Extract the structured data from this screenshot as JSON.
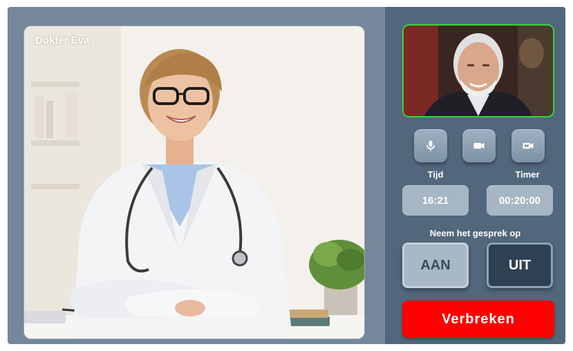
{
  "main_video": {
    "caller_name": "Dokter Eva"
  },
  "controls": {
    "icons": [
      "microphone-icon",
      "camera-icon",
      "video-off-icon"
    ]
  },
  "time": {
    "label": "Tijd",
    "value": "16:21"
  },
  "timer": {
    "label": "Timer",
    "value": "00:20:00"
  },
  "recording": {
    "label": "Neem het gesprek op",
    "on_label": "AAN",
    "off_label": "UIT",
    "selected": "UIT"
  },
  "hangup": {
    "label": "Verbreken"
  },
  "colors": {
    "frame": "#75889b",
    "panel": "#52677b",
    "self_view_border": "#35d63a",
    "hangup": "#ff0000"
  }
}
